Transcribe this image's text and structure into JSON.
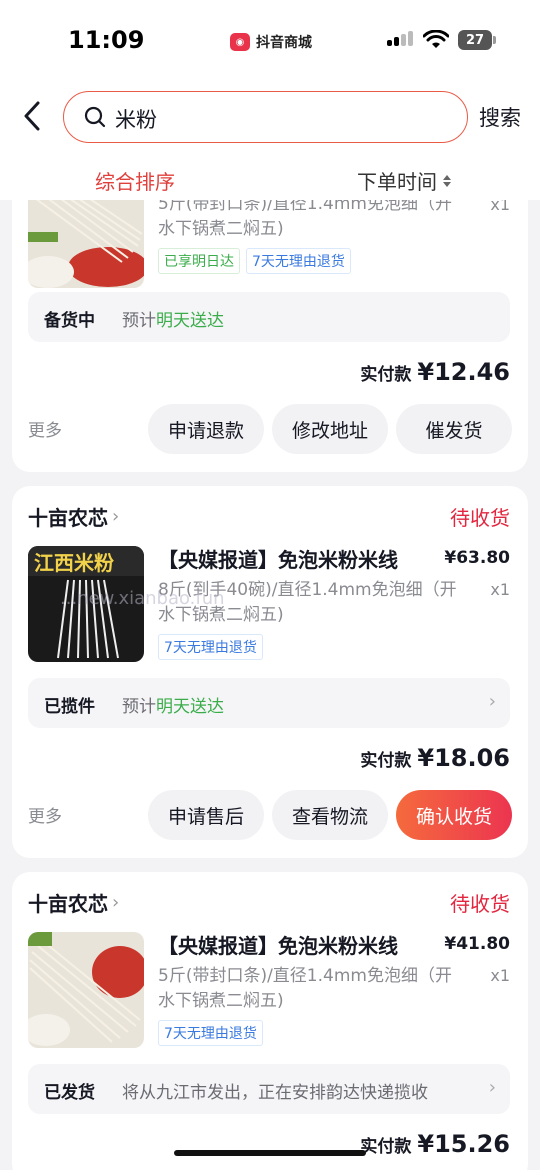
{
  "status_bar": {
    "time": "11:09",
    "app": "抖音商城",
    "battery": "27"
  },
  "search": {
    "value": "米粉",
    "button": "搜索"
  },
  "sort": {
    "comprehensive": "综合排序",
    "order_time": "下单时间"
  },
  "orders": [
    {
      "spec_line1": "5斤(带封口条)/直径1.4mm免泡细（开",
      "spec_line2": "水下锅煮二焖五)",
      "qty": "x1",
      "tags": [
        "已享明日达",
        "7天无理由退货"
      ],
      "ship_status": "备货中",
      "ship_prefix": "预计",
      "ship_highlight": "明天送达",
      "paid_label": "实付款",
      "paid_amount": "¥12.46",
      "more": "更多",
      "buttons": [
        "申请退款",
        "修改地址",
        "催发货"
      ]
    },
    {
      "shop": "十亩农芯",
      "status": "待收货",
      "title": "【央媒报道】免泡米粉米线",
      "price": "¥63.80",
      "spec_line1": "8斤(到手40碗)/直径1.4mm免泡细（开",
      "spec_line2": "水下锅煮二焖五)",
      "qty": "x1",
      "tags": [
        "7天无理由退货"
      ],
      "thumb_text": "江西米粉",
      "ship_status": "已揽件",
      "ship_prefix": "预计",
      "ship_highlight": "明天送达",
      "paid_label": "实付款",
      "paid_amount": "¥18.06",
      "more": "更多",
      "buttons": [
        "申请售后",
        "查看物流",
        "确认收货"
      ]
    },
    {
      "shop": "十亩农芯",
      "status": "待收货",
      "title": "【央媒报道】免泡米粉米线",
      "price": "¥41.80",
      "spec_line1": "5斤(带封口条)/直径1.4mm免泡细（开",
      "spec_line2": "水下锅煮二焖五)",
      "qty": "x1",
      "tags": [
        "7天无理由退货"
      ],
      "ship_status": "已发货",
      "ship_note": "将从九江市发出，正在安排韵达快递揽收",
      "paid_label": "实付款",
      "paid_amount": "¥15.26"
    }
  ],
  "watermark": "...new.xianbao.fun",
  "colors": {
    "accent": "#e0403c",
    "status_red": "#e3263f",
    "green": "#3aad4a",
    "tag_blue": "#3a7ae0"
  }
}
